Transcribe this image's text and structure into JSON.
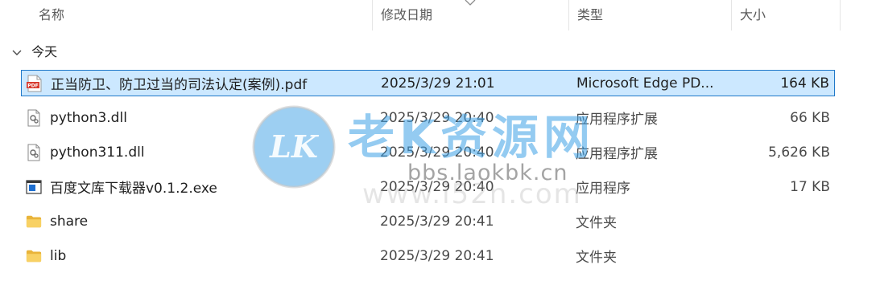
{
  "columns": {
    "name": "名称",
    "date": "修改日期",
    "type": "类型",
    "size": "大小"
  },
  "group": {
    "label": "今天"
  },
  "files": [
    {
      "name": "正当防卫、防卫过当的司法认定(案例).pdf",
      "date": "2025/3/29 21:01",
      "type": "Microsoft Edge PD...",
      "size": "164 KB",
      "icon": "pdf-file-icon",
      "selected": true
    },
    {
      "name": "python3.dll",
      "date": "2025/3/29 20:40",
      "type": "应用程序扩展",
      "size": "66 KB",
      "icon": "dll-file-icon",
      "selected": false
    },
    {
      "name": "python311.dll",
      "date": "2025/3/29 20:40",
      "type": "应用程序扩展",
      "size": "5,626 KB",
      "icon": "dll-file-icon",
      "selected": false
    },
    {
      "name": "百度文库下载器v0.1.2.exe",
      "date": "2025/3/29 20:40",
      "type": "应用程序",
      "size": "17 KB",
      "icon": "exe-file-icon",
      "selected": false
    },
    {
      "name": "share",
      "date": "2025/3/29 20:41",
      "type": "文件夹",
      "size": "",
      "icon": "folder-icon",
      "selected": false
    },
    {
      "name": "lib",
      "date": "2025/3/29 20:41",
      "type": "文件夹",
      "size": "",
      "icon": "folder-icon",
      "selected": false
    }
  ],
  "watermark": {
    "brand": "老K资源网",
    "url1": "bbs.laokbk.cn",
    "url2": "www.i52n.com",
    "logo_text": "LK"
  },
  "colors": {
    "selection_bg": "#cce8ff",
    "selection_border": "#1f78c9",
    "folder": "#f4c542",
    "pdf": "#d83b2f"
  }
}
